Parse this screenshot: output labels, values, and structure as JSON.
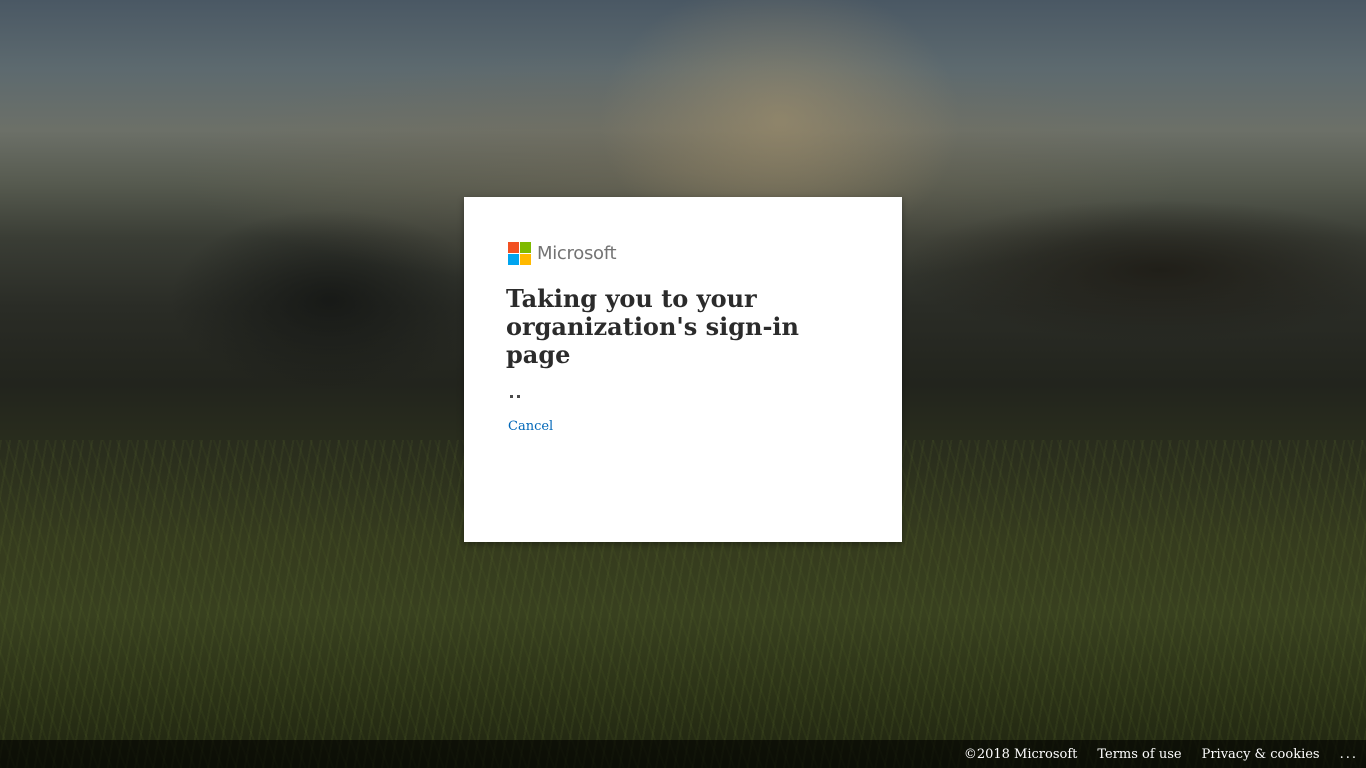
{
  "brand": {
    "name": "Microsoft",
    "logo_colors": [
      "#f25022",
      "#7fba00",
      "#00a4ef",
      "#ffb900"
    ]
  },
  "dialog": {
    "title": "Taking you to your organization's sign-in page",
    "cancel_label": "Cancel",
    "link_color": "#0067b8"
  },
  "footer": {
    "copyright": "©2018 Microsoft",
    "terms": "Terms of use",
    "privacy": "Privacy & cookies",
    "more": "..."
  }
}
